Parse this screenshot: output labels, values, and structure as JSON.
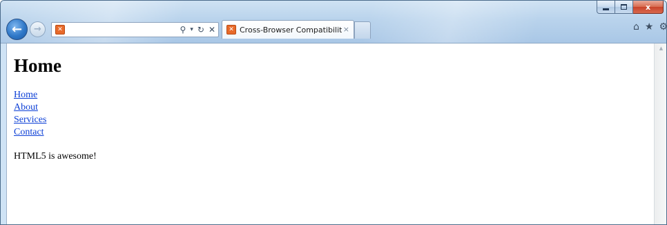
{
  "window": {
    "caption": {
      "minimize": "",
      "maximize": "",
      "close": "x"
    }
  },
  "nav": {
    "back_icon": "back-arrow-icon",
    "forward_icon": "forward-arrow-icon"
  },
  "address": {
    "value": "",
    "favicon": "xampp-icon",
    "tools": {
      "search": "search-icon",
      "dropdown": "chevron-down-icon",
      "refresh": "refresh-icon",
      "stop": "stop-icon"
    }
  },
  "tabs": [
    {
      "title": "Cross-Browser Compatibilit...",
      "close": "×",
      "favicon": "xampp-icon",
      "active": true
    }
  ],
  "toolbar": {
    "home": "home-icon",
    "favorites": "star-icon",
    "tools": "gear-icon"
  },
  "page": {
    "heading": "Home",
    "links": [
      "Home",
      "About",
      "Services",
      "Contact"
    ],
    "text": "HTML5 is awesome!"
  },
  "colors": {
    "link": "#0c3fd6",
    "chrome": "#b9d3ec",
    "close_button": "#c7432a",
    "favicon": "#e86a2a"
  }
}
